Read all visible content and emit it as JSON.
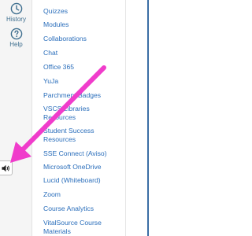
{
  "global_nav": {
    "history_label": "History",
    "help_label": "Help"
  },
  "course_nav": {
    "items": [
      {
        "label": "Quizzes"
      },
      {
        "label": "Modules"
      },
      {
        "label": "Collaborations"
      },
      {
        "label": "Chat"
      },
      {
        "label": "Office 365"
      },
      {
        "label": "YuJa"
      },
      {
        "label": "Parchment Badges"
      },
      {
        "label": "VSCS Libraries Resources"
      },
      {
        "label": "Student Success Resources"
      },
      {
        "label": "SSE Connect (Aviso)"
      },
      {
        "label": "Microsoft OneDrive"
      },
      {
        "label": "Lucid (Whiteboard)"
      },
      {
        "label": "Zoom"
      },
      {
        "label": "Course Analytics"
      },
      {
        "label": "VitalSource Course Materials"
      }
    ]
  },
  "colors": {
    "link": "#2a6ebb",
    "nav_icon": "#3f6f8f",
    "annotation_arrow": "#f03ccb",
    "right_border": "#3b6ea5"
  },
  "icons": {
    "history": "clock-icon",
    "help": "question-circle-icon",
    "audio": "speaker-icon"
  }
}
